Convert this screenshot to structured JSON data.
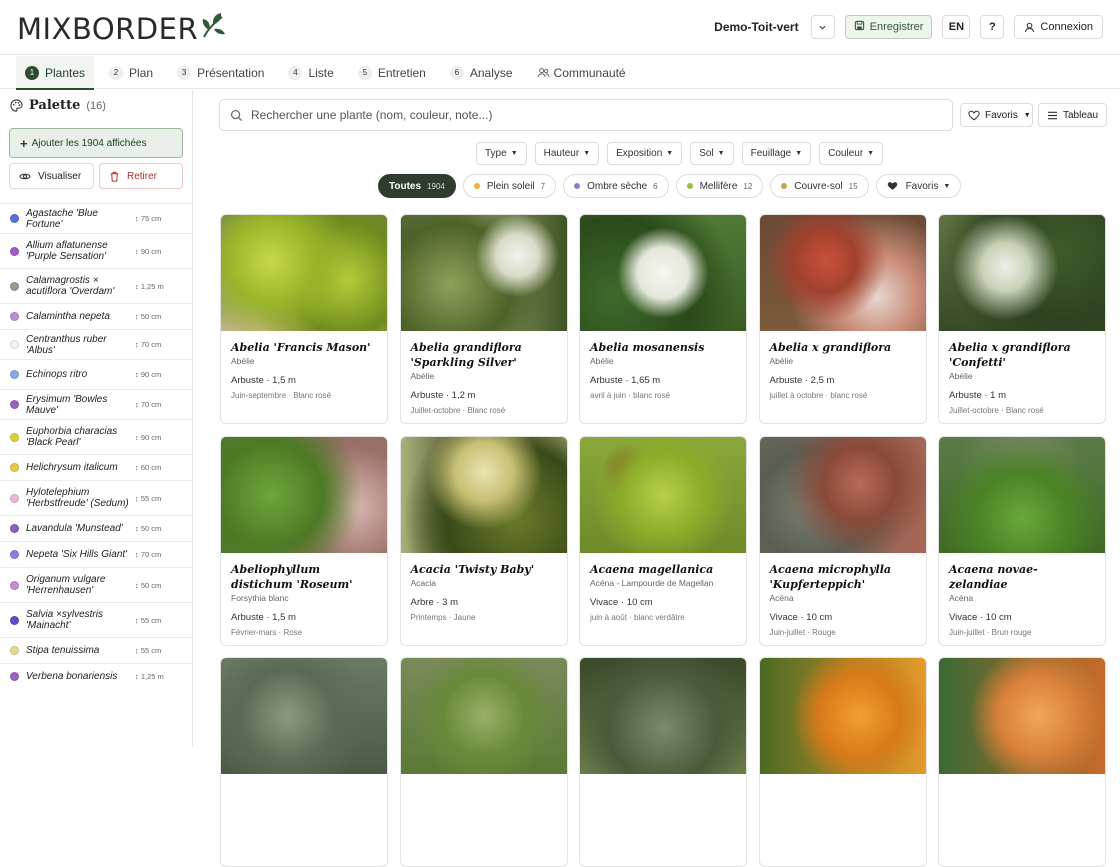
{
  "header": {
    "logo_text": "MIXBORDER",
    "project_name": "Demo-Toit-vert",
    "save_label": "Enregistrer",
    "lang_label": "EN",
    "help_label": "?",
    "login_label": "Connexion"
  },
  "tabs": [
    {
      "num": "1",
      "label": "Plantes"
    },
    {
      "num": "2",
      "label": "Plan"
    },
    {
      "num": "3",
      "label": "Présentation"
    },
    {
      "num": "4",
      "label": "Liste"
    },
    {
      "num": "5",
      "label": "Entretien"
    },
    {
      "num": "6",
      "label": "Analyse"
    },
    {
      "num": "",
      "label": "Communauté"
    }
  ],
  "sidebar": {
    "title": "Palette",
    "count": "(16)",
    "add_label": "Ajouter les 1904 affichées",
    "view_label": "Visualiser",
    "remove_label": "Retirer",
    "plants": [
      {
        "name": "Agastache 'Blue Fortune'",
        "height": "↕ 75 cm",
        "color": "#5a6fd8"
      },
      {
        "name": "Allium aflatunense 'Purple Sensation'",
        "height": "↕ 90 cm",
        "color": "#a25ac9"
      },
      {
        "name": "Calamagrostis × acutiflora 'Overdam'",
        "height": "↕ 1,25 m",
        "color": "#9a9a8a"
      },
      {
        "name": "Calamintha nepeta",
        "height": "↕ 50 cm",
        "color": "#b98fd0"
      },
      {
        "name": "Centranthus ruber 'Albus'",
        "height": "↕ 70 cm",
        "color": "#f4f4ee"
      },
      {
        "name": "Echinops ritro",
        "height": "↕ 90 cm",
        "color": "#8aa6e6"
      },
      {
        "name": "Erysimum 'Bowles Mauve'",
        "height": "↕ 70 cm",
        "color": "#9a62c0"
      },
      {
        "name": "Euphorbia characias 'Black Pearl'",
        "height": "↕ 90 cm",
        "color": "#d9d13a"
      },
      {
        "name": "Helichrysum italicum",
        "height": "↕ 60 cm",
        "color": "#e8c84a"
      },
      {
        "name": "Hylotelephium 'Herbstfreude' (Sedum)",
        "height": "↕ 55 cm",
        "color": "#e6b8d6"
      },
      {
        "name": "Lavandula 'Munstead'",
        "height": "↕ 50 cm",
        "color": "#8b5fc0"
      },
      {
        "name": "Nepeta 'Six Hills Giant'",
        "height": "↕ 70 cm",
        "color": "#8a7ee0"
      },
      {
        "name": "Origanum vulgare 'Herrenhausen'",
        "height": "↕ 50 cm",
        "color": "#c48ad6"
      },
      {
        "name": "Salvia ×sylvestris 'Mainacht'",
        "height": "↕ 55 cm",
        "color": "#5b4fc8"
      },
      {
        "name": "Stipa tenuissima",
        "height": "↕ 55 cm",
        "color": "#e8d98a"
      },
      {
        "name": "Verbena bonariensis",
        "height": "↕ 1,25 m",
        "color": "#a061c8"
      }
    ]
  },
  "search": {
    "placeholder": "Rechercher une plante (nom, couleur, note...)"
  },
  "toolbar": {
    "favorites_label": "Favoris",
    "table_label": "Tableau"
  },
  "filters": [
    "Type",
    "Hauteur",
    "Exposition",
    "Sol",
    "Feuillage",
    "Couleur"
  ],
  "chips": [
    {
      "label": "Toutes",
      "count": "1904",
      "active": true,
      "color": ""
    },
    {
      "label": "Plein soleil",
      "count": "7",
      "active": false,
      "color": "#e2b43a"
    },
    {
      "label": "Ombre sèche",
      "count": "6",
      "active": false,
      "color": "#8b7ec8"
    },
    {
      "label": "Mellifère",
      "count": "12",
      "active": false,
      "color": "#9abf3a"
    },
    {
      "label": "Couvre-sol",
      "count": "15",
      "active": false,
      "color": "#c9a24a"
    },
    {
      "label": "Favoris",
      "count": "",
      "active": false,
      "color": ""
    }
  ],
  "cards": [
    {
      "name": "Abelia 'Francis Mason'",
      "common": "Abélie",
      "type": "Arbuste · 1,5 m",
      "flower": "Juin-septembre · Blanc rosé"
    },
    {
      "name": "Abelia grandiflora 'Sparkling Silver'",
      "common": "Abélie",
      "type": "Arbuste · 1,2 m",
      "flower": "Juillet-octobre · Blanc rosé"
    },
    {
      "name": "Abelia mosanensis",
      "common": "Abélie",
      "type": "Arbuste · 1,65 m",
      "flower": "avril à juin · blanc rosé"
    },
    {
      "name": "Abelia x grandiflora",
      "common": "Abélie",
      "type": "Arbuste · 2,5 m",
      "flower": "juillet à octobre · blanc rosé"
    },
    {
      "name": "Abelia x grandiflora 'Confetti'",
      "common": "Abélie",
      "type": "Arbuste · 1 m",
      "flower": "Juillet-octobre · Blanc rosé"
    },
    {
      "name": "Abeliophyllum distichum 'Roseum'",
      "common": "Forsythia blanc",
      "type": "Arbuste · 1,5 m",
      "flower": "Février-mars · Rose"
    },
    {
      "name": "Acacia 'Twisty Baby'",
      "common": "Acacia",
      "type": "Arbre · 3 m",
      "flower": "Printemps · Jaune"
    },
    {
      "name": "Acaena magellanica",
      "common": "Acéna - Lampourde de Magellan",
      "type": "Vivace · 10 cm",
      "flower": "juin à août · blanc verdâtre"
    },
    {
      "name": "Acaena microphylla 'Kupferteppich'",
      "common": "Acéna",
      "type": "Vivace · 10 cm",
      "flower": "Juin-juillet · Rouge"
    },
    {
      "name": "Acaena novae-zelandiae",
      "common": "Acéna",
      "type": "Vivace · 10 cm",
      "flower": "Juin-juillet · Brun rouge"
    }
  ]
}
